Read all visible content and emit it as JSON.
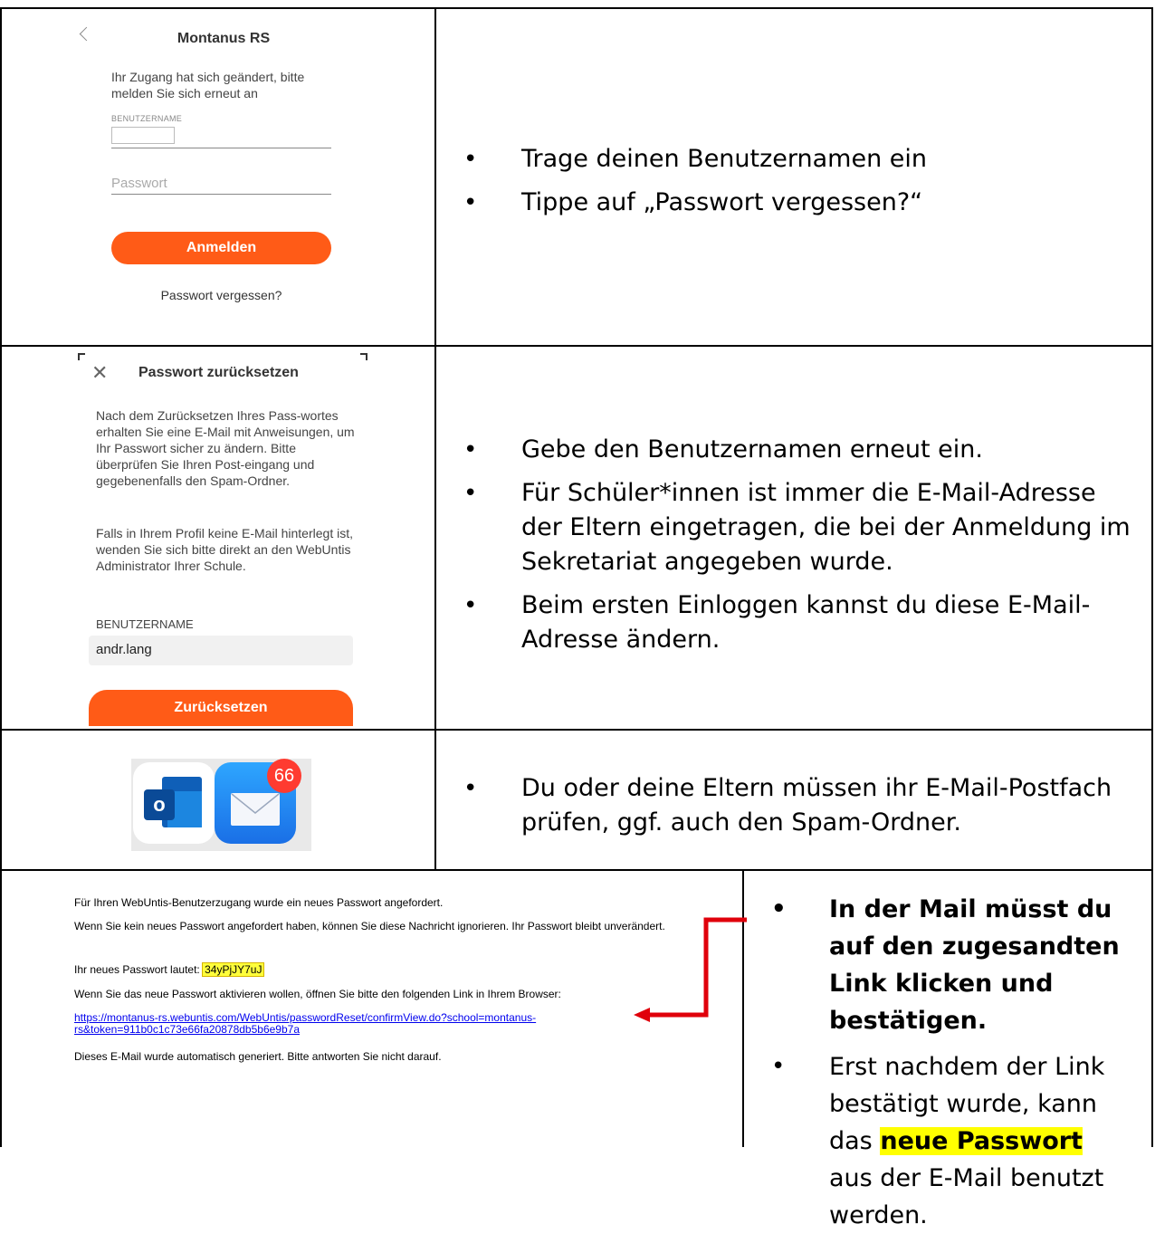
{
  "panel1": {
    "app_title": "Montanus RS",
    "hint": "Ihr Zugang hat sich geändert, bitte melden Sie sich erneut an",
    "username_label": "BENUTZERNAME",
    "password_placeholder": "Passwort",
    "login_button": "Anmelden",
    "forgot_link": "Passwort vergessen?",
    "bullets": [
      "Trage deinen Benutzernamen ein",
      "Tippe auf „Passwort vergessen?“"
    ]
  },
  "panel2": {
    "title": "Passwort zurücksetzen",
    "para1": "Nach dem Zurücksetzen Ihres Pass-wortes erhalten Sie eine E-Mail mit Anweisungen, um Ihr Passwort sicher zu ändern. Bitte überprüfen Sie Ihren Post-eingang und gegebenenfalls den Spam-Ordner.",
    "para2": "Falls in Ihrem Profil keine E-Mail hinterlegt ist, wenden Sie sich bitte direkt an den WebUntis Administrator Ihrer Schule.",
    "username_label": "BENUTZERNAME",
    "username_value": "andr.lang",
    "reset_button": "Zurücksetzen",
    "bullets": [
      "Gebe den Benutzernamen erneut ein.",
      "Für Schüler*innen ist immer die E-Mail-Adresse der Eltern eingetragen, die bei der Anmeldung im Sekretariat angegeben wurde.",
      "Beim ersten Einloggen kannst du diese E-Mail-Adresse ändern."
    ]
  },
  "panel3": {
    "outlook_letter": "o",
    "badge_count": "66",
    "bullets": [
      "Du oder deine Eltern müssen ihr E-Mail-Postfach prüfen, ggf. auch den Spam-Ordner."
    ]
  },
  "panel4": {
    "line1": "Für Ihren WebUntis-Benutzerzugang wurde ein neues Passwort angefordert.",
    "line2": "Wenn Sie kein neues Passwort angefordert haben, können Sie diese Nachricht ignorieren. Ihr Passwort bleibt unverändert.",
    "line3_prefix": "Ihr neues Passwort lautet:",
    "new_password": "34yPjJY7uJ",
    "line4": "Wenn Sie das neue Passwort aktivieren wollen, öffnen Sie bitte den folgenden Link in Ihrem Browser:",
    "link": "https://montanus-rs.webuntis.com/WebUntis/passwordReset/confirmView.do?school=montanus-rs&token=911b0c1c73e66fa20878db5b6e9b7a",
    "line5": "Dieses E-Mail wurde automatisch generiert. Bitte antworten Sie nicht darauf.",
    "bullet1": "In der Mail müsst du auf den zugesandten Link klicken und bestätigen.",
    "bullet2_before": "Erst nachdem der Link bestätigt wurde, kann das",
    "bullet2_highlight": "neue Passwort",
    "bullet2_after": "aus der E-Mail benutzt werden."
  },
  "colors": {
    "accent_orange": "#ff5b17",
    "arrow_red": "#e0000b",
    "highlight_yellow": "#ffff00",
    "badge_red": "#ff3b30"
  }
}
